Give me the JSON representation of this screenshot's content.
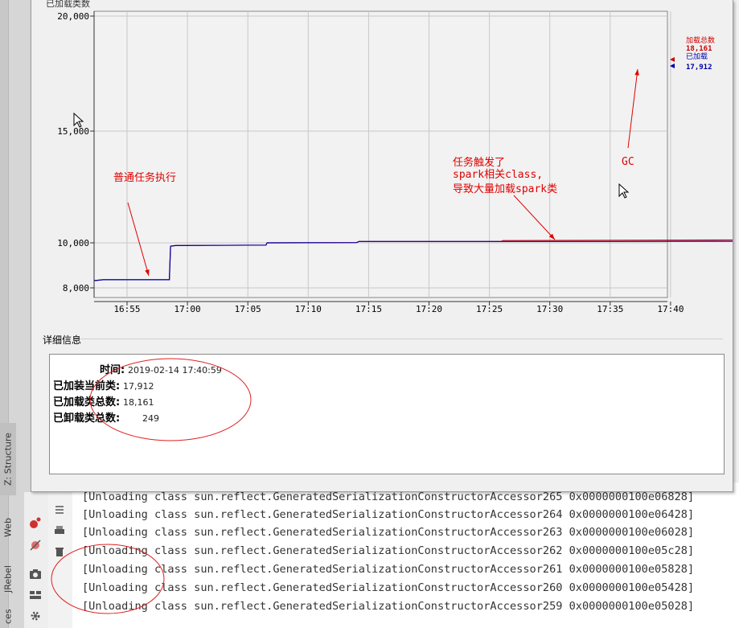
{
  "ide": {
    "tabs": [
      "Z: Structure",
      "Web",
      "JRebel",
      "ces"
    ]
  },
  "chart_data": {
    "type": "line",
    "title": "已加载类数",
    "x": [
      "16:55",
      "17:00",
      "17:05",
      "17:10",
      "17:15",
      "17:20",
      "17:25",
      "17:30",
      "17:35",
      "17:40"
    ],
    "y_ticks": [
      "20,000",
      "15,000",
      "10,000",
      "8,000"
    ],
    "ylim": [
      8000,
      20000
    ],
    "series": [
      {
        "name": "加载总数",
        "color": "#cc0000",
        "last_value": "18,161"
      },
      {
        "name": "已加载",
        "color": "#0000aa",
        "last_value": "17,912"
      }
    ],
    "annotations": [
      {
        "text": "普通任务执行"
      },
      {
        "text": "任务触发了"
      },
      {
        "text": "spark相关class,"
      },
      {
        "text": "导致大量加载spark类"
      },
      {
        "text": "GC"
      }
    ]
  },
  "details": {
    "title": "详细信息",
    "rows": [
      {
        "label": "时间:",
        "value": "2019-02-14 17:40:59"
      },
      {
        "label": "已加装当前类:",
        "value": "17,912"
      },
      {
        "label": "已加载类总数:",
        "value": "18,161"
      },
      {
        "label": "已卸载类总数:",
        "value": "249"
      }
    ]
  },
  "console": {
    "lines": [
      "[Unloading class sun.reflect.GeneratedSerializationConstructorAccessor265 0x0000000100e06828]",
      "[Unloading class sun.reflect.GeneratedSerializationConstructorAccessor264 0x0000000100e06428]",
      "[Unloading class sun.reflect.GeneratedSerializationConstructorAccessor263 0x0000000100e06028]",
      "[Unloading class sun.reflect.GeneratedSerializationConstructorAccessor262 0x0000000100e05c28]",
      "[Unloading class sun.reflect.GeneratedSerializationConstructorAccessor261 0x0000000100e05828]",
      "[Unloading class sun.reflect.GeneratedSerializationConstructorAccessor260 0x0000000100e05428]",
      "[Unloading class sun.reflect.GeneratedSerializationConstructorAccessor259 0x0000000100e05028]"
    ],
    "tools": [
      "soft-wrap-icon",
      "print-icon",
      "trash-icon"
    ]
  },
  "colors": {
    "total_series": "#cc0000",
    "loaded_series": "#0000aa",
    "annotation": "#e00000",
    "grid": "#c8c8c8",
    "plot_bg": "#f2f2f2"
  }
}
